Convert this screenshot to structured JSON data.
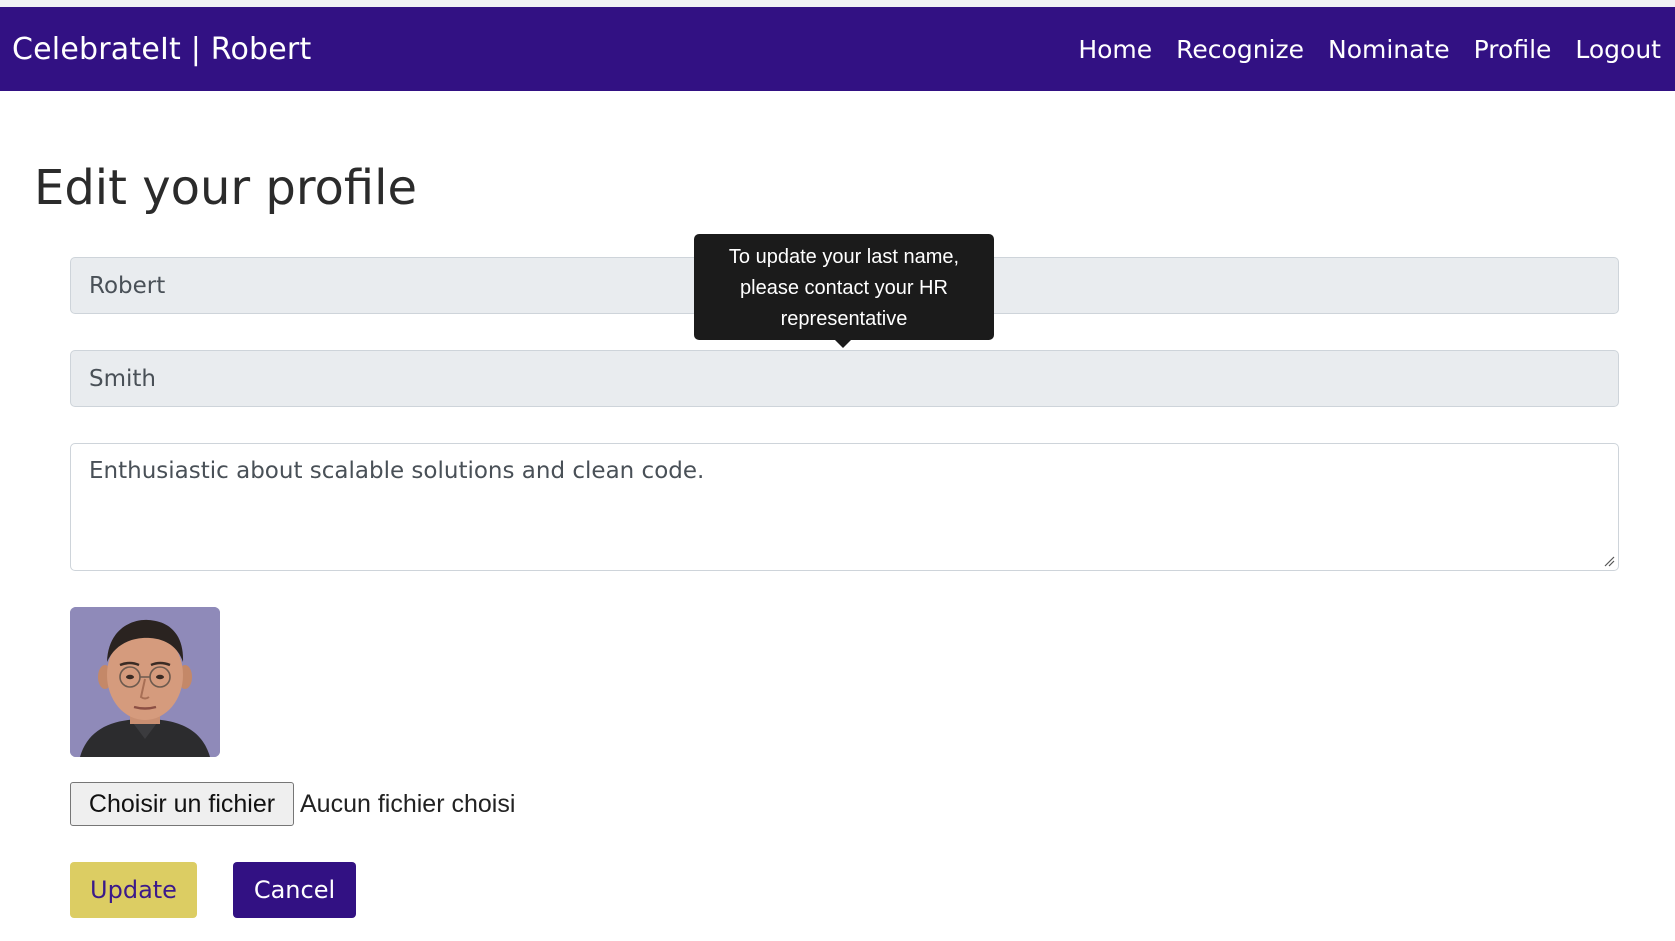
{
  "app": {
    "brand": "CelebrateIt | Robert"
  },
  "nav": {
    "items": [
      {
        "label": "Home"
      },
      {
        "label": "Recognize"
      },
      {
        "label": "Nominate"
      },
      {
        "label": "Profile"
      },
      {
        "label": "Logout"
      }
    ]
  },
  "page": {
    "title": "Edit your profile"
  },
  "form": {
    "first_name": "Robert",
    "last_name": "Smith",
    "bio": "Enthusiastic about scalable solutions and clean code.",
    "file_button_label": "Choisir un fichier",
    "file_status": "Aucun fichier choisi",
    "update_label": "Update",
    "cancel_label": "Cancel"
  },
  "tooltip": {
    "lines": [
      "To update your last name,",
      "please contact your HR",
      "representative"
    ]
  },
  "colors": {
    "navbar": "#321183",
    "update_button": "#dccd63",
    "cancel_button": "#321183",
    "input_disabled": "#e9ecef",
    "tooltip": "#1b1b1b"
  }
}
